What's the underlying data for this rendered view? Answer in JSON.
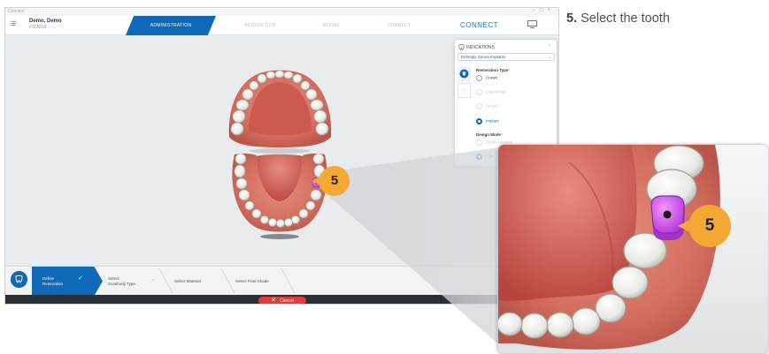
{
  "window": {
    "title": "Connect"
  },
  "header": {
    "patient_name": "Demo, Demo",
    "patient_id": "#113018",
    "tabs": [
      "ADMINISTRATION",
      "ACQUISITION",
      "MODEL",
      "CONNECT"
    ],
    "active_tab": "ADMINISTRATION",
    "connect_label": "CONNECT"
  },
  "indications": {
    "title": "INDICATIONS",
    "manufacturer": "Dentsply Sirona Implants",
    "restoration_type_label": "Restoration Type",
    "restoration_options": [
      "Crown",
      "Inlay/Onlay",
      "Veneer",
      "Implant"
    ],
    "selected_restoration": "Implant",
    "design_mode_label": "Design Mode",
    "design_mode_options": [
      "Screw-retained",
      "Cem..."
    ]
  },
  "wizard": {
    "steps": [
      "Define Restoration",
      "Select Scanbody Type",
      "Select Material",
      "Select Final Shade"
    ],
    "active_step": "Define Restoration",
    "cancel_label": "Cancel"
  },
  "annotation": {
    "callout_number": "5",
    "zoom_callout_number": "5"
  },
  "caption": {
    "step_number": "5.",
    "text": "Select the tooth"
  },
  "colors": {
    "accent": "#1068b8",
    "callout": "#f4a934",
    "implant_marker": "#c040e0",
    "cancel": "#e03a3a"
  }
}
